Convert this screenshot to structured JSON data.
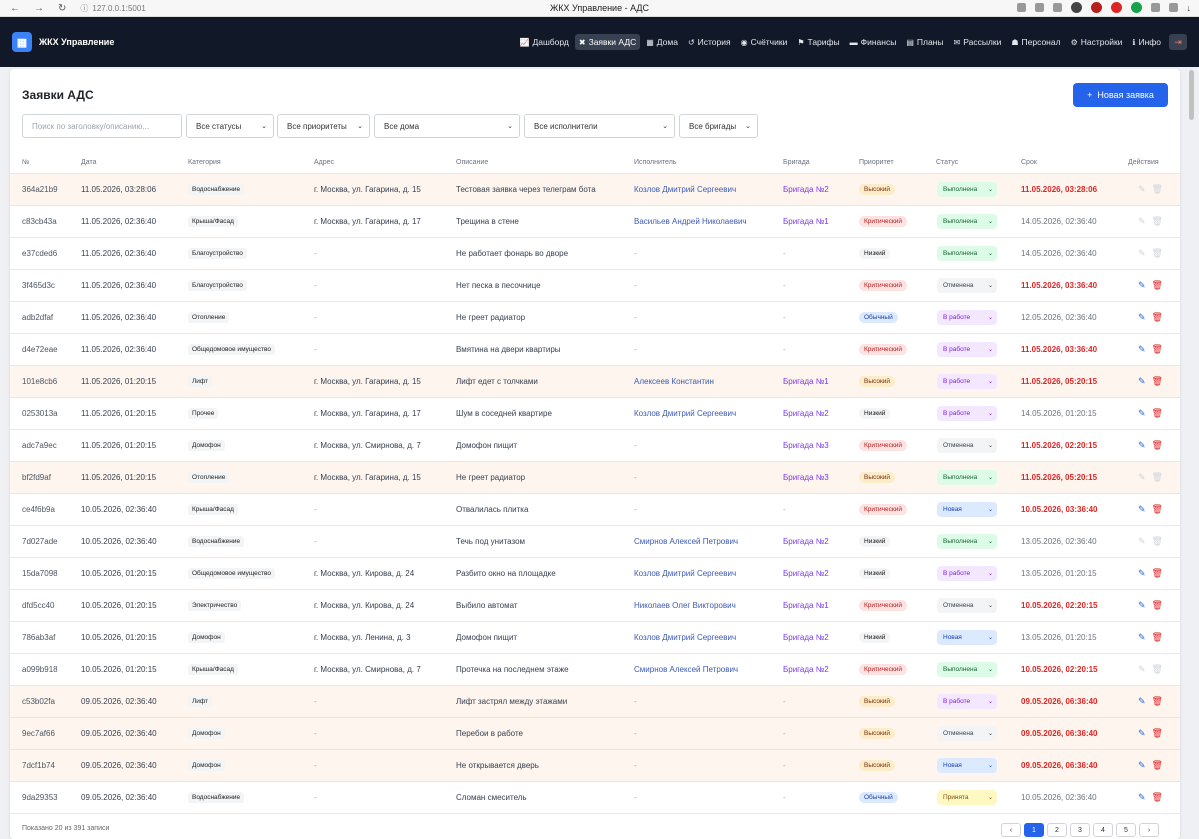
{
  "browser": {
    "url": "127.0.0.1:5001",
    "tab_title": "ЖКХ Управление - АДС"
  },
  "app": {
    "brand": "ЖКХ Управление",
    "logout_icon": "logout-icon"
  },
  "nav": [
    {
      "icon": "chart-icon",
      "glyph": "📈",
      "label": "Дашборд"
    },
    {
      "icon": "tools-icon",
      "glyph": "✖",
      "label": "Заявки АДС",
      "active": true
    },
    {
      "icon": "building-icon",
      "glyph": "▦",
      "label": "Дома"
    },
    {
      "icon": "history-icon",
      "glyph": "↺",
      "label": "История"
    },
    {
      "icon": "gauge-icon",
      "glyph": "◉",
      "label": "Счётчики"
    },
    {
      "icon": "tag-icon",
      "glyph": "⚑",
      "label": "Тарифы"
    },
    {
      "icon": "money-icon",
      "glyph": "▬",
      "label": "Финансы"
    },
    {
      "icon": "calendar-icon",
      "glyph": "▤",
      "label": "Планы"
    },
    {
      "icon": "mail-icon",
      "glyph": "✉",
      "label": "Рассылки"
    },
    {
      "icon": "users-icon",
      "glyph": "☗",
      "label": "Персонал"
    },
    {
      "icon": "gear-icon",
      "glyph": "⚙",
      "label": "Настройки"
    },
    {
      "icon": "info-icon",
      "glyph": "ℹ",
      "label": "Инфо"
    }
  ],
  "page": {
    "title": "Заявки АДС",
    "new_button": "Новая заявка"
  },
  "filters": {
    "search_placeholder": "Поиск по заголовку/описанию...",
    "status": "Все статусы",
    "priority": "Все приоритеты",
    "house": "Все дома",
    "executor": "Все исполнители",
    "brigade": "Все бригады"
  },
  "columns": [
    "№",
    "Дата",
    "Категория",
    "Адрес",
    "Описание",
    "Исполнитель",
    "Бригада",
    "Приоритет",
    "Статус",
    "Срок",
    "Действия"
  ],
  "rows": [
    {
      "id": "364a21b9",
      "date": "11.05.2026, 03:28:06",
      "category": "Водоснабжение",
      "address": "г. Москва, ул. Гагарина, д. 15",
      "desc": "Тестовая заявка через телеграм бота",
      "executor": "Козлов Дмитрий Сергеевич",
      "brigade": "Бригада №2",
      "priority": "Высокий",
      "ptype": "high",
      "status": "Выполнена",
      "stype": "done",
      "deadline": "11.05.2026, 03:28:06",
      "dred": true,
      "hl": true,
      "dis": true
    },
    {
      "id": "c83cb43a",
      "date": "11.05.2026, 02:36:40",
      "category": "Крыша/Фасад",
      "address": "г. Москва, ул. Гагарина, д. 17",
      "desc": "Трещина в стене",
      "executor": "Васильев Андрей Николаевич",
      "brigade": "Бригада №1",
      "priority": "Критический",
      "ptype": "crit",
      "status": "Выполнена",
      "stype": "done",
      "deadline": "14.05.2026, 02:36:40",
      "dred": false,
      "hl": false,
      "dis": true
    },
    {
      "id": "e37cded6",
      "date": "11.05.2026, 02:36:40",
      "category": "Благоустройство",
      "address": "-",
      "desc": "Не работает фонарь во дворе",
      "executor": "-",
      "brigade": "-",
      "priority": "Низкий",
      "ptype": "low",
      "status": "Выполнена",
      "stype": "done",
      "deadline": "14.05.2026, 02:36:40",
      "dred": false,
      "hl": false,
      "dis": true
    },
    {
      "id": "3f465d3c",
      "date": "11.05.2026, 02:36:40",
      "category": "Благоустройство",
      "address": "-",
      "desc": "Нет песка в песочнице",
      "executor": "-",
      "brigade": "-",
      "priority": "Критический",
      "ptype": "crit",
      "status": "Отменена",
      "stype": "cancel",
      "deadline": "11.05.2026, 03:36:40",
      "dred": true,
      "hl": false,
      "dis": false
    },
    {
      "id": "adb2dfaf",
      "date": "11.05.2026, 02:36:40",
      "category": "Отопление",
      "address": "-",
      "desc": "Не греет радиатор",
      "executor": "-",
      "brigade": "-",
      "priority": "Обычный",
      "ptype": "norm",
      "status": "В работе",
      "stype": "work",
      "deadline": "12.05.2026, 02:36:40",
      "dred": false,
      "hl": false,
      "dis": false
    },
    {
      "id": "d4e72eae",
      "date": "11.05.2026, 02:36:40",
      "category": "Общедомовое имущество",
      "address": "-",
      "desc": "Вмятина на двери квартиры",
      "executor": "-",
      "brigade": "-",
      "priority": "Критический",
      "ptype": "crit",
      "status": "В работе",
      "stype": "work",
      "deadline": "11.05.2026, 03:36:40",
      "dred": true,
      "hl": false,
      "dis": false
    },
    {
      "id": "101e8cb6",
      "date": "11.05.2026, 01:20:15",
      "category": "Лифт",
      "address": "г. Москва, ул. Гагарина, д. 15",
      "desc": "Лифт едет с толчками",
      "executor": "Алексеев Константин",
      "brigade": "Бригада №1",
      "priority": "Высокий",
      "ptype": "high",
      "status": "В работе",
      "stype": "work",
      "deadline": "11.05.2026, 05:20:15",
      "dred": true,
      "hl": true,
      "dis": false
    },
    {
      "id": "0253013a",
      "date": "11.05.2026, 01:20:15",
      "category": "Прочее",
      "address": "г. Москва, ул. Гагарина, д. 17",
      "desc": "Шум в соседней квартире",
      "executor": "Козлов Дмитрий Сергеевич",
      "brigade": "Бригада №2",
      "priority": "Низкий",
      "ptype": "low",
      "status": "В работе",
      "stype": "work",
      "deadline": "14.05.2026, 01:20:15",
      "dred": false,
      "hl": false,
      "dis": false
    },
    {
      "id": "adc7a9ec",
      "date": "11.05.2026, 01:20:15",
      "category": "Домофон",
      "address": "г. Москва, ул. Смирнова, д. 7",
      "desc": "Домофон пищит",
      "executor": "-",
      "brigade": "Бригада №3",
      "priority": "Критический",
      "ptype": "crit",
      "status": "Отменена",
      "stype": "cancel",
      "deadline": "11.05.2026, 02:20:15",
      "dred": true,
      "hl": false,
      "dis": false
    },
    {
      "id": "bf2fd9af",
      "date": "11.05.2026, 01:20:15",
      "category": "Отопление",
      "address": "г. Москва, ул. Гагарина, д. 15",
      "desc": "Не греет радиатор",
      "executor": "-",
      "brigade": "Бригада №3",
      "priority": "Высокий",
      "ptype": "high",
      "status": "Выполнена",
      "stype": "done",
      "deadline": "11.05.2026, 05:20:15",
      "dred": true,
      "hl": true,
      "dis": true
    },
    {
      "id": "ce4f6b9a",
      "date": "10.05.2026, 02:36:40",
      "category": "Крыша/Фасад",
      "address": "-",
      "desc": "Отвалилась плитка",
      "executor": "-",
      "brigade": "-",
      "priority": "Критический",
      "ptype": "crit",
      "status": "Новая",
      "stype": "new",
      "deadline": "10.05.2026, 03:36:40",
      "dred": true,
      "hl": false,
      "dis": false
    },
    {
      "id": "7d027ade",
      "date": "10.05.2026, 02:36:40",
      "category": "Водоснабжение",
      "address": "-",
      "desc": "Течь под унитазом",
      "executor": "Смирнов Алексей Петрович",
      "brigade": "Бригада №2",
      "priority": "Низкий",
      "ptype": "low",
      "status": "Выполнена",
      "stype": "done",
      "deadline": "13.05.2026, 02:36:40",
      "dred": false,
      "hl": false,
      "dis": true
    },
    {
      "id": "15da7098",
      "date": "10.05.2026, 01:20:15",
      "category": "Общедомовое имущество",
      "address": "г. Москва, ул. Кирова, д. 24",
      "desc": "Разбито окно на площадке",
      "executor": "Козлов Дмитрий Сергеевич",
      "brigade": "Бригада №2",
      "priority": "Низкий",
      "ptype": "low",
      "status": "В работе",
      "stype": "work",
      "deadline": "13.05.2026, 01:20:15",
      "dred": false,
      "hl": false,
      "dis": false
    },
    {
      "id": "dfd5cc40",
      "date": "10.05.2026, 01:20:15",
      "category": "Электричество",
      "address": "г. Москва, ул. Кирова, д. 24",
      "desc": "Выбило автомат",
      "executor": "Николаев Олег Викторович",
      "brigade": "Бригада №1",
      "priority": "Критический",
      "ptype": "crit",
      "status": "Отменена",
      "stype": "cancel",
      "deadline": "10.05.2026, 02:20:15",
      "dred": true,
      "hl": false,
      "dis": false
    },
    {
      "id": "786ab3af",
      "date": "10.05.2026, 01:20:15",
      "category": "Домофон",
      "address": "г. Москва, ул. Ленина, д. 3",
      "desc": "Домофон пищит",
      "executor": "Козлов Дмитрий Сергеевич",
      "brigade": "Бригада №2",
      "priority": "Низкий",
      "ptype": "low",
      "status": "Новая",
      "stype": "new",
      "deadline": "13.05.2026, 01:20:15",
      "dred": false,
      "hl": false,
      "dis": false
    },
    {
      "id": "a099b918",
      "date": "10.05.2026, 01:20:15",
      "category": "Крыша/Фасад",
      "address": "г. Москва, ул. Смирнова, д. 7",
      "desc": "Протечка на последнем этаже",
      "executor": "Смирнов Алексей Петрович",
      "brigade": "Бригада №2",
      "priority": "Критический",
      "ptype": "crit",
      "status": "Выполнена",
      "stype": "done",
      "deadline": "10.05.2026, 02:20:15",
      "dred": true,
      "hl": false,
      "dis": true
    },
    {
      "id": "c53b02fa",
      "date": "09.05.2026, 02:36:40",
      "category": "Лифт",
      "address": "-",
      "desc": "Лифт застрял между этажами",
      "executor": "-",
      "brigade": "-",
      "priority": "Высокий",
      "ptype": "high",
      "status": "В работе",
      "stype": "work",
      "deadline": "09.05.2026, 06:36:40",
      "dred": true,
      "hl": true,
      "dis": false
    },
    {
      "id": "9ec7af66",
      "date": "09.05.2026, 02:36:40",
      "category": "Домофон",
      "address": "-",
      "desc": "Перебои в работе",
      "executor": "-",
      "brigade": "-",
      "priority": "Высокий",
      "ptype": "high",
      "status": "Отменена",
      "stype": "cancel",
      "deadline": "09.05.2026, 06:36:40",
      "dred": true,
      "hl": true,
      "dis": false
    },
    {
      "id": "7dcf1b74",
      "date": "09.05.2026, 02:36:40",
      "category": "Домофон",
      "address": "-",
      "desc": "Не открывается дверь",
      "executor": "-",
      "brigade": "-",
      "priority": "Высокий",
      "ptype": "high",
      "status": "Новая",
      "stype": "new",
      "deadline": "09.05.2026, 06:36:40",
      "dred": true,
      "hl": true,
      "dis": false
    },
    {
      "id": "9da29353",
      "date": "09.05.2026, 02:36:40",
      "category": "Водоснабжение",
      "address": "-",
      "desc": "Сломан смеситель",
      "executor": "-",
      "brigade": "-",
      "priority": "Обычный",
      "ptype": "norm",
      "status": "Принята",
      "stype": "acc",
      "deadline": "10.05.2026, 02:36:40",
      "dred": false,
      "hl": false,
      "dis": false
    }
  ],
  "pager": {
    "info": "Показано 20 из 391 записи",
    "pages": [
      "‹",
      "1",
      "2",
      "3",
      "4",
      "5",
      "›"
    ],
    "current": "1"
  }
}
